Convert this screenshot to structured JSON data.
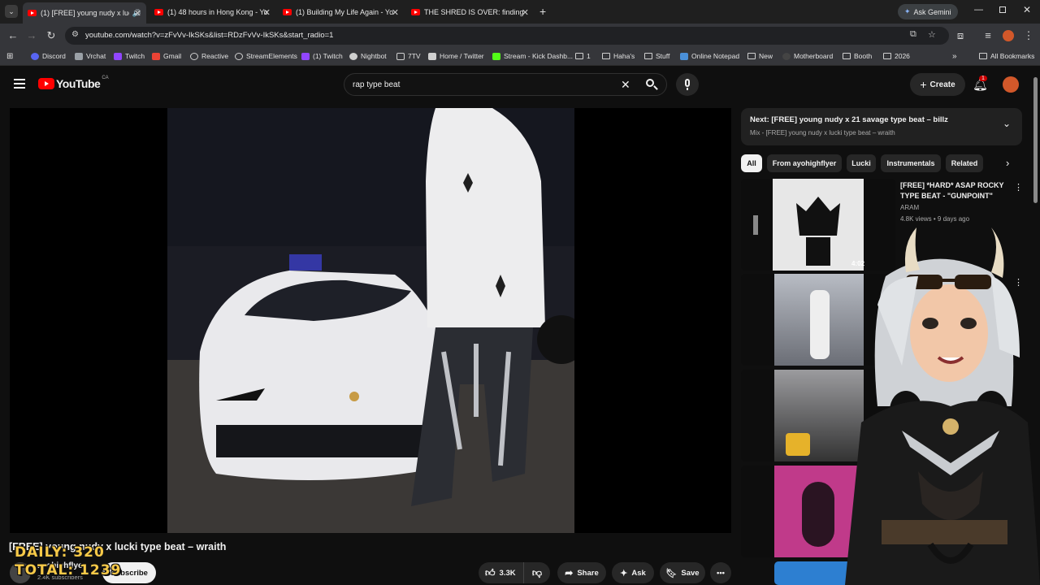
{
  "browser": {
    "tabs": [
      {
        "title": "(1) [FREE] young nudy x luci",
        "active": true,
        "audio": true
      },
      {
        "title": "(1) 48 hours in Hong Kong - Yo",
        "active": false
      },
      {
        "title": "(1) Building My Life Again - Yo",
        "active": false
      },
      {
        "title": "THE SHRED IS OVER: finding my",
        "active": false
      }
    ],
    "ask_gemini": "Ask Gemini",
    "url": "youtube.com/watch?v=zFvVv-IkSKs&list=RDzFvVv-IkSKs&start_radio=1",
    "bookmarks": [
      {
        "label": "Discord",
        "color": "#5865f2"
      },
      {
        "label": "Vrchat",
        "color": "#9aa0a6"
      },
      {
        "label": "Twitch",
        "color": "#9146ff"
      },
      {
        "label": "Gmail",
        "color": "#ea4335"
      },
      {
        "label": "Reactive",
        "color": "#cfcfcf"
      },
      {
        "label": "StreamElements",
        "color": "#cfcfcf"
      },
      {
        "label": "(1) Twitch",
        "color": "#9146ff"
      },
      {
        "label": "Nightbot",
        "color": "#cfcfcf"
      },
      {
        "label": "7TV",
        "color": "#cfcfcf"
      },
      {
        "label": "Home / Twitter",
        "color": "#cfcfcf"
      },
      {
        "label": "Stream - Kick Dashb...",
        "color": "#53fc18"
      },
      {
        "label": "1",
        "folder": true
      },
      {
        "label": "Haha's",
        "folder": true
      },
      {
        "label": "Stuff",
        "folder": true
      },
      {
        "label": "Online Notepad",
        "color": "#4a90d9"
      },
      {
        "label": "New",
        "folder": true
      },
      {
        "label": "Motherboard",
        "color": "#444"
      },
      {
        "label": "Booth",
        "folder": true
      },
      {
        "label": "2026",
        "folder": true
      }
    ],
    "all_bookmarks": "All Bookmarks"
  },
  "youtube": {
    "logo_text": "YouTube",
    "region": "CA",
    "search_query": "rap type beat",
    "create_label": "Create",
    "notification_count": "1",
    "video": {
      "title": "[FREE] young nudy x lucki type beat – wraith",
      "channel": "ayohighflyer",
      "subscribers": "2.4K subscribers",
      "subscribe_label": "Subscribe",
      "likes": "3.3K",
      "share_label": "Share",
      "ask_label": "Ask",
      "save_label": "Save"
    },
    "next": {
      "title": "Next: [FREE] young nudy x 21 savage type beat – billz",
      "subtitle": "Mix - [FREE] young nudy x lucki type beat – wraith"
    },
    "chips": [
      "All",
      "From ayohighflyer",
      "Lucki",
      "Instrumentals",
      "Related"
    ],
    "recommendations": [
      {
        "title": "[FREE] *HARD* ASAP ROCKY TYPE BEAT - \"GUNPOINT\"",
        "channel": "ARAM",
        "meta": "4.8K views • 9 days ago",
        "duration": "4:02"
      },
      {
        "title": "",
        "channel": "",
        "meta": "",
        "duration": "3:"
      },
      {
        "title": "",
        "channel": "",
        "meta": "",
        "duration": ""
      },
      {
        "title": "",
        "channel": "",
        "meta": "",
        "duration": "2:"
      }
    ]
  },
  "overlay": {
    "daily": "DAILY: 320",
    "total": "TOTAL: 1239"
  }
}
